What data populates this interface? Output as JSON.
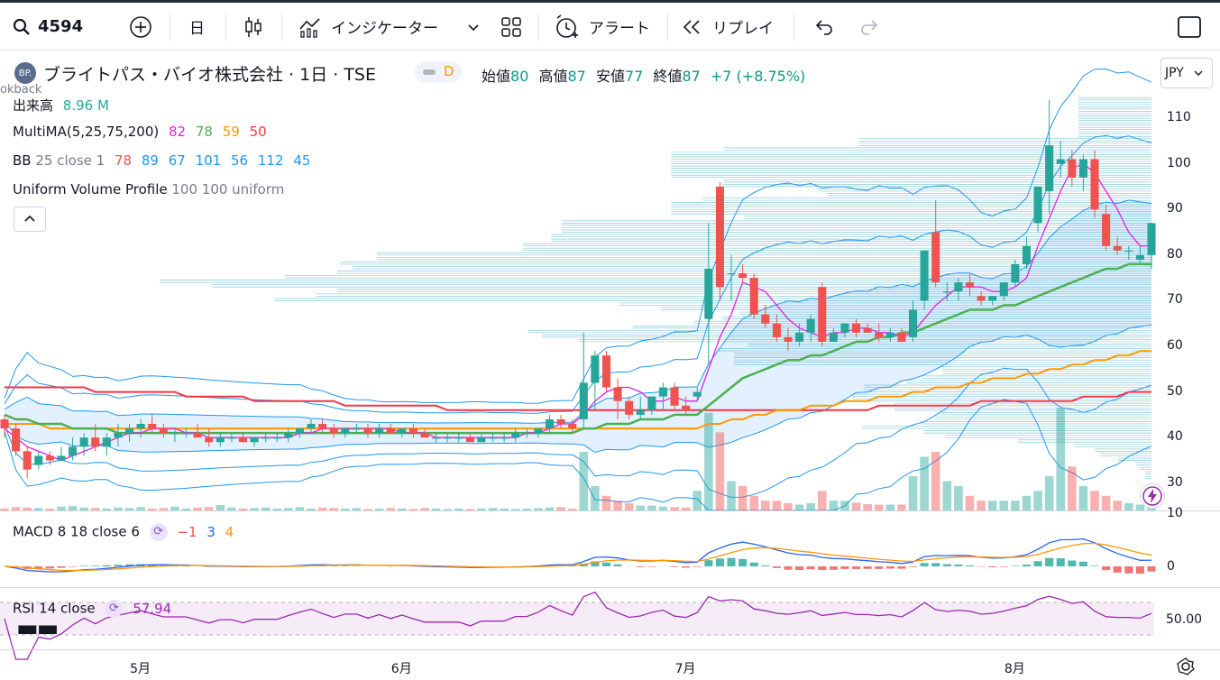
{
  "toolbar": {
    "symbol": "4594",
    "interval": "日",
    "indicators_label": "インジケーター",
    "alert_label": "アラート",
    "replay_label": "リプレイ"
  },
  "header": {
    "logo_text": "BP.",
    "title": "ブライトパス・バイオ株式会社 · 1日 · TSE",
    "delay_badge": "D",
    "open_label": "始値",
    "open_value": "80",
    "high_label": "高値",
    "high_value": "87",
    "low_label": "安値",
    "low_value": "77",
    "close_label": "終値",
    "close_value": "87",
    "change": "+7 (+8.75%)",
    "currency": "JPY",
    "lookback_text": "okback"
  },
  "legends": {
    "volume_label": "出来高",
    "volume_value": "8.96 M",
    "mma_label": "MultiMA(5,25,75,200)",
    "mma_v1": "82",
    "mma_v2": "78",
    "mma_v3": "59",
    "mma_v4": "50",
    "bb_label": "BB",
    "bb_params": "25 close 1",
    "bb_v1": "78",
    "bb_v2": "89",
    "bb_v3": "67",
    "bb_v4": "101",
    "bb_v5": "56",
    "bb_v6": "112",
    "bb_v7": "45",
    "vp_label": "Uniform Volume Profile",
    "vp_params": "100 100 uniform",
    "macd_label": "MACD",
    "macd_params": "8 18 close 6",
    "macd_v1": "−1",
    "macd_v2": "3",
    "macd_v3": "4",
    "rsi_label": "RSI",
    "rsi_params": "14 close",
    "rsi_value": "57.94"
  },
  "price_axis": [
    "110",
    "100",
    "90",
    "80",
    "70",
    "60",
    "50",
    "40",
    "30",
    "10"
  ],
  "macd_axis": [
    "0"
  ],
  "rsi_axis": [
    "50.00"
  ],
  "time_axis": [
    "5月",
    "6月",
    "7月",
    "8月"
  ],
  "colors": {
    "up": "#26a69a",
    "down": "#ef5350",
    "ma5": "#e91ee6",
    "ma25": "#4caf50",
    "ma75": "#ff9800",
    "ma200": "#f23645",
    "bb": "#2196f3",
    "macd": "#2962ff",
    "signal": "#ff9800",
    "rsi": "#9c27b0"
  },
  "chart_data": {
    "type": "candlestick",
    "title": "ブライトパス・バイオ株式会社 · 1日 · TSE",
    "ylabel": "JPY",
    "price_range": [
      27,
      116
    ],
    "candles": [
      [
        44,
        45,
        40,
        42
      ],
      [
        42,
        43,
        36,
        37
      ],
      [
        37,
        38,
        31,
        33
      ],
      [
        34,
        37,
        33,
        36
      ],
      [
        36,
        37,
        34,
        35
      ],
      [
        35,
        38,
        35,
        36
      ],
      [
        36,
        40,
        35,
        38
      ],
      [
        38,
        41,
        36,
        40
      ],
      [
        40,
        43,
        37,
        38
      ],
      [
        38,
        41,
        36,
        40
      ],
      [
        40,
        43,
        38,
        41
      ],
      [
        41,
        43,
        39,
        42
      ],
      [
        42,
        44,
        40,
        43
      ],
      [
        43,
        45,
        41,
        42
      ],
      [
        42,
        43,
        40,
        41
      ],
      [
        41,
        42,
        39,
        41
      ],
      [
        41,
        42,
        40,
        41
      ],
      [
        41,
        43,
        40,
        40
      ],
      [
        40,
        42,
        38,
        39
      ],
      [
        39,
        41,
        38,
        40
      ],
      [
        40,
        41,
        39,
        40
      ],
      [
        40,
        41,
        39,
        39
      ],
      [
        39,
        40,
        38,
        40
      ],
      [
        40,
        41,
        39,
        40
      ],
      [
        40,
        41,
        39,
        40
      ],
      [
        40,
        42,
        39,
        41
      ],
      [
        41,
        42,
        40,
        42
      ],
      [
        42,
        44,
        41,
        43
      ],
      [
        43,
        44,
        41,
        42
      ],
      [
        42,
        43,
        40,
        41
      ],
      [
        41,
        42,
        40,
        42
      ],
      [
        42,
        43,
        41,
        42
      ],
      [
        42,
        43,
        40,
        41
      ],
      [
        41,
        43,
        40,
        42
      ],
      [
        42,
        43,
        41,
        41
      ],
      [
        41,
        42,
        40,
        42
      ],
      [
        42,
        43,
        40,
        41
      ],
      [
        41,
        42,
        40,
        40
      ],
      [
        40,
        41,
        39,
        40
      ],
      [
        40,
        41,
        39,
        40
      ],
      [
        40,
        41,
        39,
        40
      ],
      [
        40,
        41,
        39,
        39
      ],
      [
        39,
        41,
        39,
        40
      ],
      [
        40,
        41,
        39,
        40
      ],
      [
        40,
        41,
        39,
        40
      ],
      [
        40,
        42,
        39,
        41
      ],
      [
        41,
        42,
        40,
        41
      ],
      [
        41,
        42,
        40,
        42
      ],
      [
        42,
        45,
        41,
        44
      ],
      [
        44,
        45,
        42,
        43
      ],
      [
        43,
        44,
        41,
        42
      ],
      [
        44,
        63,
        42,
        52
      ],
      [
        52,
        59,
        46,
        58
      ],
      [
        58,
        59,
        50,
        51
      ],
      [
        51,
        53,
        44,
        48
      ],
      [
        48,
        49,
        44,
        45
      ],
      [
        45,
        49,
        44,
        46
      ],
      [
        46,
        49,
        45,
        49
      ],
      [
        49,
        52,
        46,
        51
      ],
      [
        51,
        52,
        46,
        47
      ],
      [
        47,
        49,
        45,
        46
      ],
      [
        49,
        51,
        48,
        50
      ],
      [
        66,
        87,
        56,
        77
      ],
      [
        95,
        96,
        70,
        73
      ],
      [
        76,
        80,
        70,
        76
      ],
      [
        76,
        78,
        74,
        75
      ],
      [
        75,
        76,
        66,
        67
      ],
      [
        67,
        69,
        64,
        65
      ],
      [
        65,
        67,
        61,
        62
      ],
      [
        62,
        64,
        59,
        61
      ],
      [
        61,
        65,
        60,
        63
      ],
      [
        63,
        67,
        61,
        66
      ],
      [
        73,
        74,
        60,
        61
      ],
      [
        61,
        64,
        61,
        63
      ],
      [
        63,
        65,
        62,
        65
      ],
      [
        65,
        66,
        62,
        63
      ],
      [
        64,
        65,
        63,
        63
      ],
      [
        63,
        65,
        61,
        62
      ],
      [
        62,
        64,
        61,
        63
      ],
      [
        63,
        64,
        61,
        61
      ],
      [
        62,
        70,
        61,
        68
      ],
      [
        70,
        80,
        68,
        81
      ],
      [
        85,
        92,
        73,
        74
      ],
      [
        72,
        74,
        70,
        72
      ],
      [
        72,
        75,
        70,
        74
      ],
      [
        74,
        76,
        71,
        73
      ],
      [
        71,
        72,
        69,
        70
      ],
      [
        70,
        71,
        69,
        71
      ],
      [
        71,
        74,
        70,
        74
      ],
      [
        74,
        79,
        73,
        78
      ],
      [
        78,
        84,
        77,
        82
      ],
      [
        87,
        93,
        85,
        95
      ],
      [
        94,
        114,
        89,
        104
      ],
      [
        100,
        105,
        97,
        101
      ],
      [
        101,
        103,
        95,
        97
      ],
      [
        97,
        102,
        94,
        101
      ],
      [
        101,
        103,
        88,
        90
      ],
      [
        89,
        91,
        81,
        82
      ],
      [
        82,
        84,
        80,
        81
      ],
      [
        81,
        82,
        79,
        81
      ],
      [
        79,
        82,
        78,
        80
      ],
      [
        80,
        87,
        77,
        87
      ]
    ],
    "ma5": [
      42,
      40,
      38,
      37,
      36,
      35,
      36,
      37,
      38,
      39,
      40,
      41,
      41,
      42,
      42,
      42,
      41,
      41,
      40,
      40,
      40,
      40,
      40,
      40,
      40,
      40,
      41,
      41,
      42,
      42,
      42,
      42,
      42,
      42,
      42,
      41,
      41,
      41,
      40,
      40,
      40,
      40,
      40,
      40,
      40,
      40,
      41,
      41,
      42,
      43,
      43,
      45,
      48,
      50,
      51,
      51,
      50,
      48,
      48,
      49,
      48,
      48,
      55,
      62,
      67,
      74,
      73,
      72,
      69,
      66,
      64,
      63,
      62,
      63,
      63,
      64,
      64,
      63,
      63,
      62,
      63,
      66,
      69,
      71,
      73,
      73,
      73,
      72,
      72,
      73,
      75,
      82,
      88,
      94,
      99,
      100,
      98,
      94,
      90,
      85,
      82,
      82
    ],
    "ma25": [
      45,
      44,
      44,
      43,
      43,
      43,
      42,
      42,
      42,
      42,
      41,
      41,
      41,
      41,
      41,
      41,
      41,
      41,
      41,
      41,
      41,
      41,
      41,
      41,
      41,
      41,
      41,
      41,
      41,
      41,
      41,
      41,
      41,
      41,
      41,
      41,
      41,
      41,
      41,
      41,
      41,
      41,
      41,
      41,
      41,
      41,
      41,
      41,
      41,
      41,
      41,
      42,
      42,
      43,
      43,
      43,
      44,
      44,
      44,
      45,
      45,
      45,
      47,
      49,
      51,
      53,
      54,
      55,
      56,
      57,
      57,
      58,
      58,
      59,
      60,
      61,
      61,
      62,
      62,
      63,
      63,
      64,
      65,
      66,
      67,
      68,
      68,
      68,
      69,
      69,
      70,
      71,
      72,
      73,
      74,
      75,
      76,
      77,
      77,
      78,
      78,
      78
    ],
    "ma75": [
      43,
      43,
      43,
      43,
      42,
      42,
      42,
      42,
      42,
      42,
      42,
      42,
      42,
      42,
      42,
      42,
      42,
      42,
      42,
      42,
      42,
      42,
      42,
      42,
      42,
      42,
      42,
      42,
      42,
      42,
      42,
      42,
      42,
      42,
      42,
      42,
      42,
      42,
      42,
      42,
      42,
      42,
      42,
      42,
      42,
      42,
      42,
      42,
      42,
      42,
      42,
      42,
      42,
      42,
      42,
      42,
      42,
      42,
      42,
      42,
      42,
      42,
      43,
      43,
      44,
      44,
      45,
      45,
      46,
      46,
      46,
      47,
      47,
      47,
      48,
      48,
      48,
      49,
      49,
      49,
      50,
      50,
      51,
      51,
      51,
      52,
      52,
      53,
      53,
      53,
      54,
      54,
      55,
      55,
      56,
      56,
      57,
      57,
      58,
      58,
      59,
      59
    ],
    "ma200": [
      51,
      51,
      51,
      51,
      51,
      51,
      51,
      51,
      50,
      50,
      50,
      50,
      50,
      50,
      50,
      50,
      49,
      49,
      49,
      49,
      49,
      49,
      48,
      48,
      48,
      48,
      48,
      48,
      48,
      48,
      47,
      47,
      47,
      47,
      47,
      47,
      47,
      47,
      47,
      46,
      46,
      46,
      46,
      46,
      46,
      46,
      46,
      46,
      46,
      46,
      46,
      46,
      46,
      46,
      46,
      46,
      46,
      46,
      46,
      46,
      46,
      46,
      46,
      46,
      46,
      46,
      46,
      46,
      46,
      46,
      46,
      46,
      46,
      46,
      46,
      46,
      46,
      47,
      47,
      47,
      47,
      47,
      47,
      47,
      47,
      47,
      48,
      48,
      48,
      48,
      48,
      48,
      48,
      48,
      48,
      49,
      49,
      49,
      49,
      50,
      50,
      50
    ],
    "volume_range": [
      0,
      24
    ],
    "volumes": [
      0.4,
      0.7,
      0.6,
      0.5,
      0.4,
      0.8,
      0.9,
      0.6,
      0.5,
      0.4,
      0.6,
      0.5,
      0.7,
      0.4,
      0.5,
      0.8,
      0.4,
      0.6,
      0.7,
      1.1,
      0.6,
      0.4,
      0.5,
      0.6,
      0.4,
      0.5,
      0.7,
      0.4,
      0.6,
      0.5,
      0.4,
      0.5,
      0.3,
      0.4,
      0.5,
      0.4,
      0.3,
      0.5,
      0.4,
      0.3,
      0.4,
      0.3,
      0.4,
      0.5,
      0.4,
      0.3,
      0.4,
      0.5,
      0.6,
      0.7,
      0.4,
      12,
      5,
      3,
      2,
      1.5,
      1,
      1,
      0.8,
      0.7,
      0.6,
      4,
      20,
      16,
      6,
      5,
      3,
      2,
      2,
      1.5,
      1.2,
      1.5,
      4,
      2,
      2,
      1.6,
      1.3,
      1.2,
      1.2,
      1.2,
      7,
      11,
      12,
      6,
      5,
      3,
      2,
      2,
      2,
      2,
      3,
      4,
      7,
      21,
      9,
      5,
      4,
      3,
      2,
      1.5,
      1.2,
      1.5
    ]
  }
}
